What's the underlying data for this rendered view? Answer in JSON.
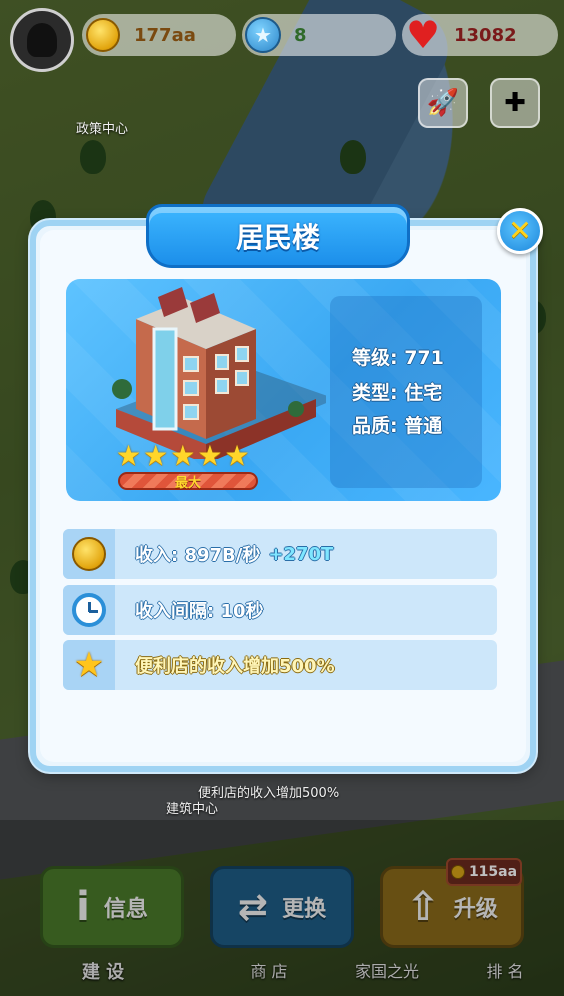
{
  "hud": {
    "coins": "177aa",
    "stars": "8",
    "hearts": "13082"
  },
  "background": {
    "policy_center": "政策中心",
    "building_center": "建筑中心",
    "bonus_hint": "便利店的收入增加500%"
  },
  "modal": {
    "title": "居民楼",
    "close_icon": "✕",
    "level": "等级: 771",
    "type": "类型: 住宅",
    "quality": "品质: 普通",
    "stars_count": 5,
    "max_label": "最大",
    "income": "收入: 897B/秒",
    "income_bonus": "+270T",
    "interval": "收入间隔: 10秒",
    "effect": "便利店的收入增加500%"
  },
  "bottom_nav": {
    "info_label": "信息",
    "swap_label": "更换",
    "upgrade_label": "升级",
    "upgrade_cost": "115aa",
    "tab_build": "建 设",
    "tab_shop": "商 店",
    "tab_homeland": "家国之光",
    "tab_rank": "排 名"
  },
  "colors": {
    "panel_blue": "#3aa8f3",
    "title_blue": "#1c8fea",
    "star_gold": "#ffd62a",
    "bonus_cyan": "#7fe6ff"
  }
}
